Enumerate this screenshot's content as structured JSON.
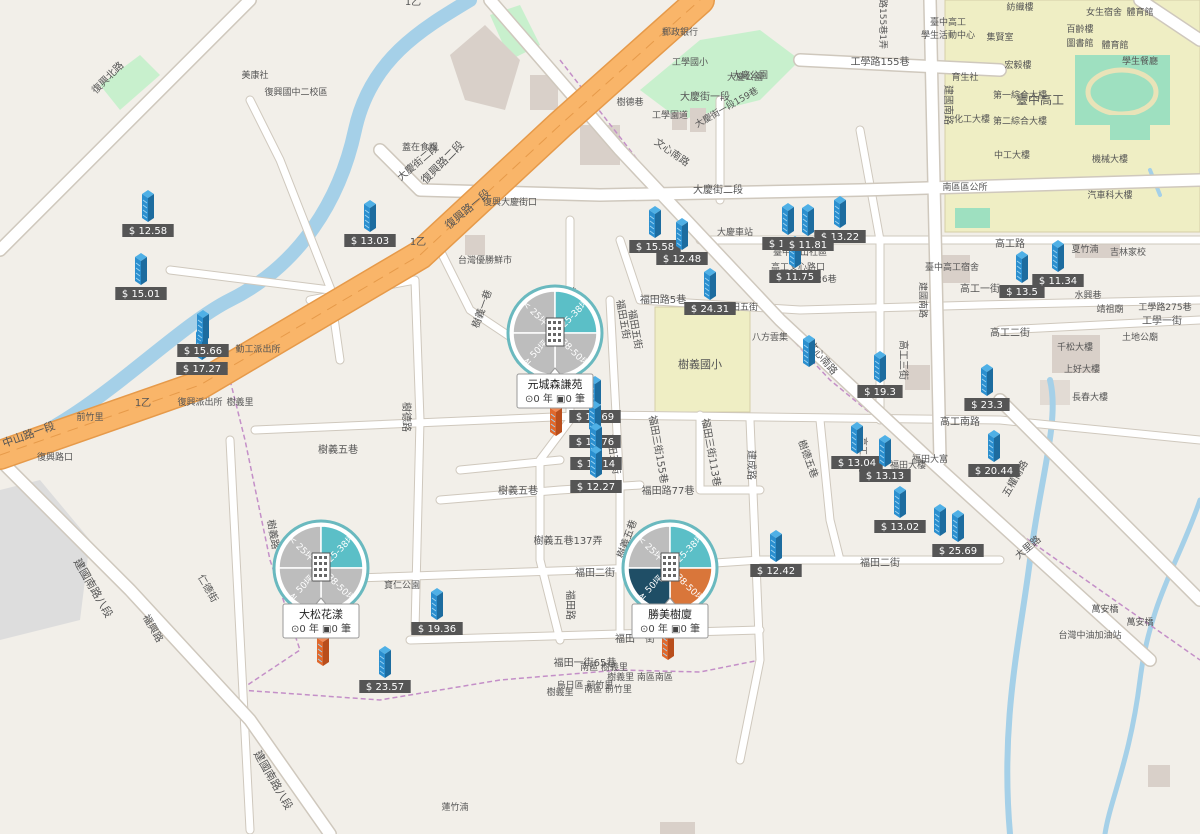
{
  "colors": {
    "land": "#f2efe9",
    "motorway": "#f9b569",
    "motorway_casing": "#e69a4a",
    "road": "#ffffff",
    "road_casing": "#cfc8bd",
    "river": "#a5d0e8",
    "park": "#c8f0cd",
    "school": "#efeec4",
    "building": "#d9d0c9",
    "boundary": "#c48fc8",
    "pin_blue": "#2b8fcf",
    "pin_orange": "#e0682c",
    "price_bg": "#555555",
    "seg_teal": "#5bbfc7",
    "seg_gray": "#bdbdbd",
    "seg_navy": "#1f4e66",
    "seg_orange": "#d9763a"
  },
  "street_labels": [
    {
      "text": "復興路二段"
    },
    {
      "text": "復興路一段"
    },
    {
      "text": "中山路一段"
    },
    {
      "text": "復興北路"
    },
    {
      "text": "大慶街二段"
    },
    {
      "text": "大慶街一段"
    },
    {
      "text": "大慶街二段"
    },
    {
      "text": "文心南路"
    },
    {
      "text": "文心南路"
    },
    {
      "text": "樹義一巷"
    },
    {
      "text": "樹義五巷"
    },
    {
      "text": "樹義五巷"
    },
    {
      "text": "樹義五巷137弄"
    },
    {
      "text": "樹義五巷"
    },
    {
      "text": "福田三街"
    },
    {
      "text": "福田三街155巷"
    },
    {
      "text": "福田三街113巷"
    },
    {
      "text": "福田路"
    },
    {
      "text": "福田路77巷"
    },
    {
      "text": "福田二街"
    },
    {
      "text": "福田二街"
    },
    {
      "text": "福田一街"
    },
    {
      "text": "福田一街65巷"
    },
    {
      "text": "福田五街"
    },
    {
      "text": "高工路"
    },
    {
      "text": "高工一街"
    },
    {
      "text": "高工二街"
    },
    {
      "text": "高工南路"
    },
    {
      "text": "高工三街"
    },
    {
      "text": "工學路155巷"
    },
    {
      "text": "工學一街"
    },
    {
      "text": "建國南路"
    },
    {
      "text": "樹德路"
    },
    {
      "text": "樹德巷"
    },
    {
      "text": "五權南路"
    },
    {
      "text": "福田路5巷"
    },
    {
      "text": "建成路"
    },
    {
      "text": "福田五街"
    },
    {
      "text": "樹義路"
    },
    {
      "text": "福興路"
    },
    {
      "text": "樹德五巷"
    },
    {
      "text": "建國南路八段"
    },
    {
      "text": "建國南路八段"
    },
    {
      "text": "仁德街"
    },
    {
      "text": "大慶街一段159巷"
    },
    {
      "text": "工學路155巷1弄"
    },
    {
      "text": "工學路275巷"
    },
    {
      "text": "大里路"
    },
    {
      "text": "福田路426巷"
    },
    {
      "text": "高工三街"
    },
    {
      "text": "建國南路"
    },
    {
      "text": "福田五街"
    }
  ],
  "poi_labels": [
    {
      "text": "美康社"
    },
    {
      "text": "復興國中二校區"
    },
    {
      "text": "臺中高工"
    },
    {
      "text": "學生活動中心"
    },
    {
      "text": "女生宿舍"
    },
    {
      "text": "體育館"
    },
    {
      "text": "紡織樓"
    },
    {
      "text": "百齡樓"
    },
    {
      "text": "集賢室"
    },
    {
      "text": "圖書館"
    },
    {
      "text": "體育館"
    },
    {
      "text": "學生餐廳"
    },
    {
      "text": "宏毅樓"
    },
    {
      "text": "育生社"
    },
    {
      "text": "第一綜合大樓"
    },
    {
      "text": "臺中高工"
    },
    {
      "text": "化工大樓"
    },
    {
      "text": "第二綜合大樓"
    },
    {
      "text": "中工大樓"
    },
    {
      "text": "機械大樓"
    },
    {
      "text": "南區區公所"
    },
    {
      "text": "汽車科大樓"
    },
    {
      "text": "大慶公園"
    },
    {
      "text": "工學國小"
    },
    {
      "text": "郵政銀行"
    },
    {
      "text": "工學園道"
    },
    {
      "text": "樹義國小"
    },
    {
      "text": "大慶車站"
    },
    {
      "text": "台灣優勝鮮市"
    },
    {
      "text": "臺中中山社區"
    },
    {
      "text": "高工文心路口"
    },
    {
      "text": "臺中高工宿舍"
    },
    {
      "text": "吉林家校"
    },
    {
      "text": "水興巷"
    },
    {
      "text": "靖祖廟"
    },
    {
      "text": "土地公廟"
    },
    {
      "text": "千松大樓"
    },
    {
      "text": "上好大樓"
    },
    {
      "text": "福田大樓"
    },
    {
      "text": "福田大富"
    },
    {
      "text": "復興大慶街口"
    },
    {
      "text": "勤工派出所"
    },
    {
      "text": "復興派出所"
    },
    {
      "text": "寶仁公園"
    },
    {
      "text": "萬安橋"
    },
    {
      "text": "樹義里"
    },
    {
      "text": "樹義里"
    },
    {
      "text": "南區 前竹里"
    },
    {
      "text": "烏日區 前竹里"
    },
    {
      "text": "樹義里 南區南區"
    },
    {
      "text": "南區 樹義里"
    },
    {
      "text": "台灣中油加油站"
    },
    {
      "text": "萬安橋"
    },
    {
      "text": "八方雲集"
    },
    {
      "text": "蓮竹湳"
    },
    {
      "text": "夏竹湳"
    },
    {
      "text": "蓋在食糧"
    },
    {
      "text": "1乙"
    },
    {
      "text": "1乙"
    },
    {
      "text": "1乙"
    },
    {
      "text": "長春大樓"
    },
    {
      "text": "復興路口"
    },
    {
      "text": "前竹里"
    },
    {
      "text": "大慶公園"
    },
    {
      "text": "樹德巷"
    },
    {
      "text": "福田路"
    }
  ],
  "price_pins": [
    {
      "price": "$ 12.58",
      "color": "blue"
    },
    {
      "price": "$ 13.03",
      "color": "blue"
    },
    {
      "price": "$ 15.01",
      "color": "blue"
    },
    {
      "price": "$ 17.27",
      "color": "blue"
    },
    {
      "price": "$ 15.66",
      "color": "blue"
    },
    {
      "price": "$ 15.58",
      "color": "blue"
    },
    {
      "price": "$ 12.48",
      "color": "blue"
    },
    {
      "price": "$ 24.31",
      "color": "blue"
    },
    {
      "price": "$ 13.69",
      "color": "blue"
    },
    {
      "price": "$ 13.76",
      "color": "blue"
    },
    {
      "price": "$ 13.14",
      "color": "blue"
    },
    {
      "price": "$ 12.27",
      "color": "blue"
    },
    {
      "price": "$ 11.75",
      "color": "blue"
    },
    {
      "price": "$ 13.22",
      "color": "blue"
    },
    {
      "price": "$ 13.5",
      "color": "blue"
    },
    {
      "price": "$ 11.34",
      "color": "blue"
    },
    {
      "price": "$ 19.3",
      "color": "blue"
    },
    {
      "price": "$ 23.3",
      "color": "blue"
    },
    {
      "price": "$ 13.04",
      "color": "blue"
    },
    {
      "price": "$ 13.13",
      "color": "blue"
    },
    {
      "price": "$ 20.44",
      "color": "blue"
    },
    {
      "price": "$ 13.02",
      "color": "blue"
    },
    {
      "price": "$ 25.69",
      "color": "blue"
    },
    {
      "price": "$ 12.42",
      "color": "blue"
    },
    {
      "price": "$ 19.36",
      "color": "blue"
    },
    {
      "price": "$ 23.57",
      "color": "blue"
    },
    {
      "price": "$ 12.11",
      "color": "blue"
    },
    {
      "price": "$ 11.81",
      "color": "blue"
    },
    {
      "price": "",
      "color": "blue"
    },
    {
      "price": "",
      "color": "blue"
    },
    {
      "price": "",
      "color": "orange"
    },
    {
      "price": "",
      "color": "orange"
    },
    {
      "price": "",
      "color": "orange"
    }
  ],
  "clusters": [
    {
      "name": "元城森謙苑",
      "stats": "⊙0 年 ▣0 筆",
      "segments": [
        {
          "label": "< 25坪",
          "color": "gray"
        },
        {
          "label": "25-38坪",
          "color": "teal"
        },
        {
          "label": "38-50坪",
          "color": "gray"
        },
        {
          "label": "≥ 50坪",
          "color": "gray"
        }
      ]
    },
    {
      "name": "大松花漾",
      "stats": "⊙0 年 ▣0 筆",
      "segments": [
        {
          "label": "< 25坪",
          "color": "gray"
        },
        {
          "label": "25-38坪",
          "color": "teal"
        },
        {
          "label": "38-50坪",
          "color": "gray"
        },
        {
          "label": "≥ 50坪",
          "color": "gray"
        }
      ]
    },
    {
      "name": "勝美樹廈",
      "stats": "⊙0 年 ▣0 筆",
      "segments": [
        {
          "label": "< 25坪",
          "color": "gray"
        },
        {
          "label": "25-38坪",
          "color": "teal"
        },
        {
          "label": "38-50坪",
          "color": "orange"
        },
        {
          "label": "≥ 50坪",
          "color": "navy"
        }
      ]
    }
  ]
}
